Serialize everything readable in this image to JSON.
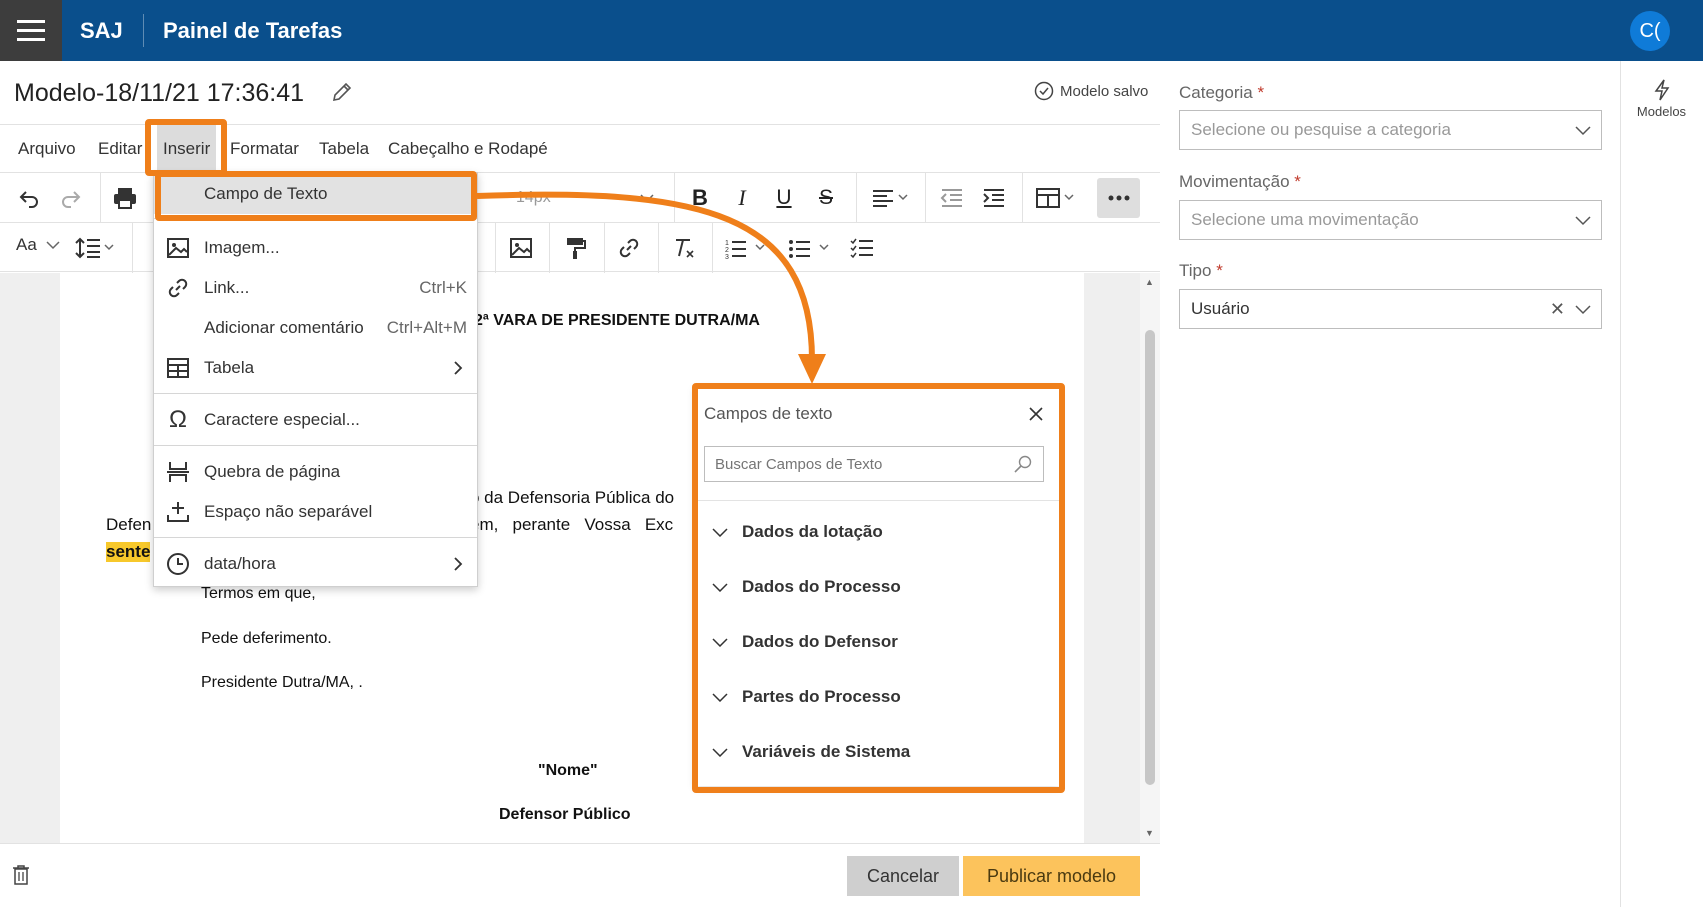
{
  "header": {
    "brand": "SAJ",
    "title": "Painel de Tarefas",
    "avatar": "C("
  },
  "document": {
    "title": "Modelo-18/11/21 17:36:41",
    "saved_status": "Modelo salvo"
  },
  "menubar": {
    "items": [
      "Arquivo",
      "Editar",
      "Inserir",
      "Formatar",
      "Tabela",
      "Cabeçalho e Rodapé"
    ]
  },
  "toolbar": {
    "font_size": "14px",
    "format_label": "Aa"
  },
  "insert_menu": {
    "items": [
      {
        "label": "Campo de Texto",
        "shortcut": "",
        "icon": "text-field-icon"
      },
      {
        "label": "Imagem...",
        "shortcut": "",
        "icon": "image-icon"
      },
      {
        "label": "Link...",
        "shortcut": "Ctrl+K",
        "icon": "link-icon"
      },
      {
        "label": "Adicionar comentário",
        "shortcut": "Ctrl+Alt+M",
        "icon": ""
      },
      {
        "label": "Tabela",
        "shortcut": "",
        "icon": "table-icon"
      },
      {
        "label": "Caractere especial...",
        "shortcut": "",
        "icon": "omega-icon"
      },
      {
        "label": "Quebra de página",
        "shortcut": "",
        "icon": "page-break-icon"
      },
      {
        "label": "Espaço não separável",
        "shortcut": "",
        "icon": "nbsp-icon"
      },
      {
        "label": "data/hora",
        "shortcut": "",
        "icon": "clock-icon"
      }
    ]
  },
  "doc_content": {
    "heading": "2ª VARA DE PRESIDENTE DUTRA/MA",
    "line1": "o da Defensoria Pública do",
    "line2_left": "Defen",
    "line2_right": "em,   perante   Vossa   Exc",
    "highlight": "sente",
    "closing1": "Termos em que,",
    "closing2": "Pede deferimento.",
    "closing3": "Presidente Dutra/MA, .",
    "signature_name": "\"Nome\"",
    "signature_role": "Defensor Público"
  },
  "campos_panel": {
    "title": "Campos de texto",
    "search_placeholder": "Buscar Campos de Texto",
    "items": [
      "Dados da lotação",
      "Dados do Processo",
      "Dados do Defensor",
      "Partes do Processo",
      "Variáveis de Sistema"
    ]
  },
  "right_panel": {
    "categoria_label": "Categoria",
    "categoria_placeholder": "Selecione ou pesquise a categoria",
    "movimentacao_label": "Movimentação",
    "movimentacao_placeholder": "Selecione uma movimentação",
    "tipo_label": "Tipo",
    "tipo_value": "Usuário",
    "required_mark": "*"
  },
  "side_strip": {
    "modelos_label": "Modelos"
  },
  "footer": {
    "cancel_label": "Cancelar",
    "publish_label": "Publicar modelo"
  },
  "colors": {
    "header_bg": "#0a4f8c",
    "accent_orange": "#ef7f1a",
    "publish_bg": "#fcc35c",
    "avatar_bg": "#0f7bd8"
  }
}
